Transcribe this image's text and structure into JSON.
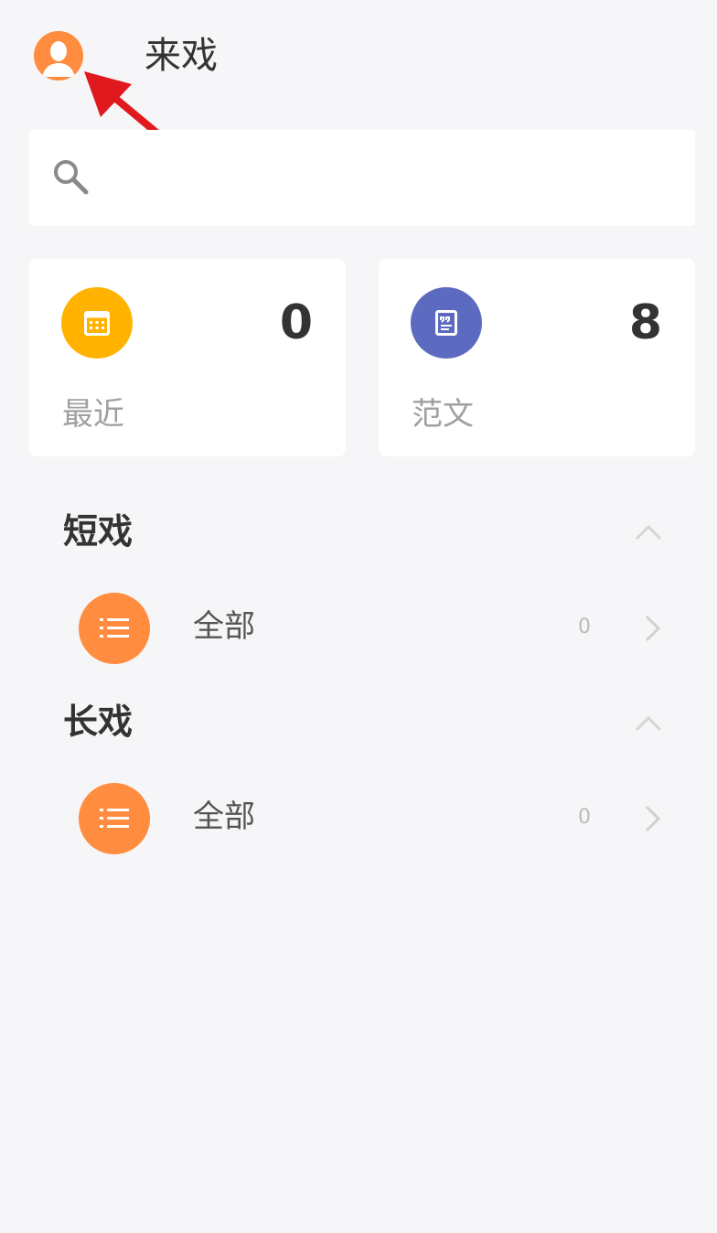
{
  "header": {
    "title": "来戏",
    "avatar_icon": "user-avatar-icon"
  },
  "search": {
    "placeholder": "",
    "icon": "search-icon"
  },
  "cards": [
    {
      "count": "0",
      "label": "最近",
      "icon": "calendar-icon",
      "color": "#ffb300"
    },
    {
      "count": "8",
      "label": "范文",
      "icon": "quote-document-icon",
      "color": "#5c6bc0"
    }
  ],
  "sections": [
    {
      "title": "短戏",
      "items": [
        {
          "label": "全部",
          "count": "0",
          "icon": "list-icon"
        }
      ]
    },
    {
      "title": "长戏",
      "items": [
        {
          "label": "全部",
          "count": "0",
          "icon": "list-icon"
        }
      ]
    }
  ],
  "colors": {
    "accent": "#ff8c3f",
    "background": "#f6f6f8",
    "annotation_arrow": "#e0191f"
  }
}
